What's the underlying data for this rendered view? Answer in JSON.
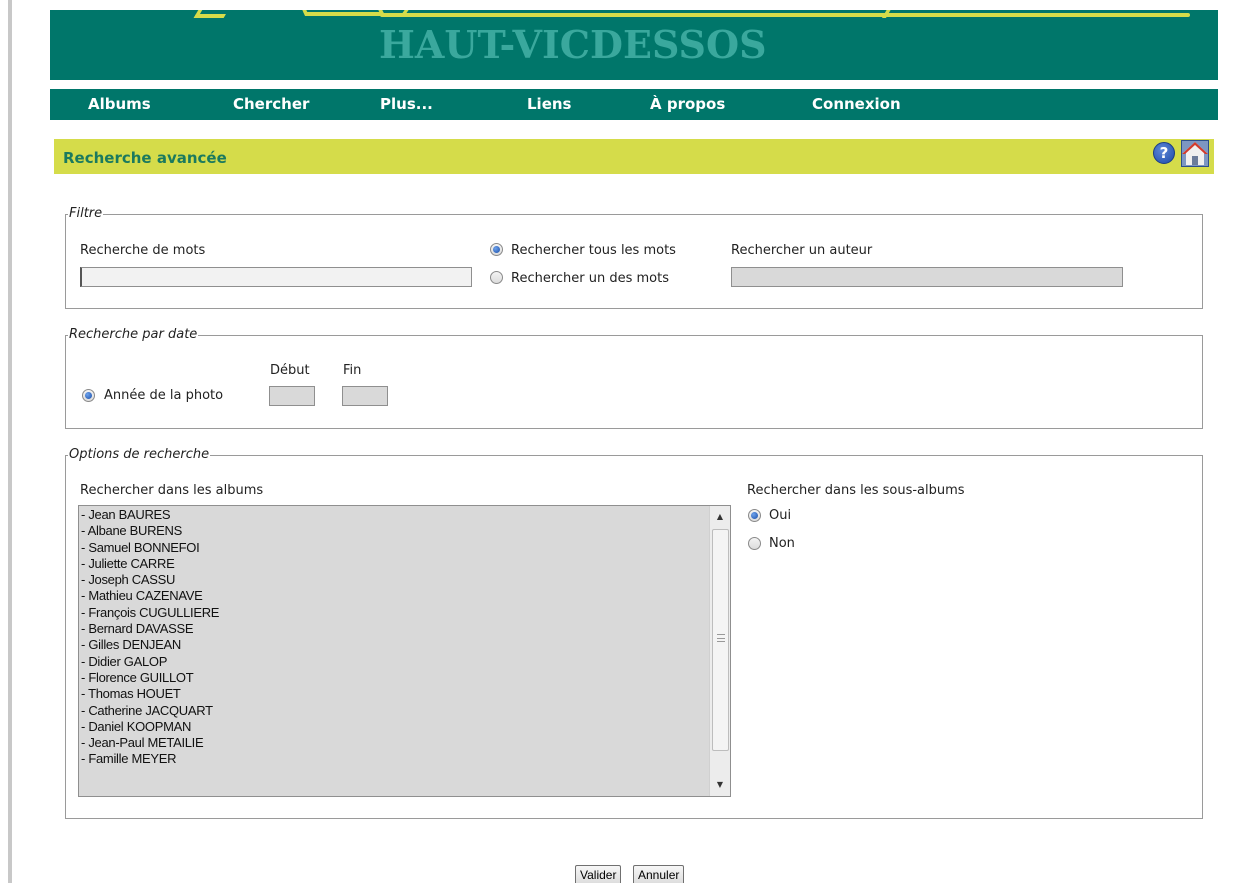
{
  "banner": {
    "title": "HAUT-VICDESSOS"
  },
  "nav": {
    "items": [
      {
        "label": "Albums"
      },
      {
        "label": "Chercher"
      },
      {
        "label": "Plus..."
      },
      {
        "label": "Liens"
      },
      {
        "label": "À propos"
      },
      {
        "label": "Connexion"
      }
    ]
  },
  "page": {
    "title": "Recherche avancée",
    "help_icon": "help-icon",
    "home_icon": "home-icon"
  },
  "filter": {
    "legend": "Filtre",
    "words_label": "Recherche de mots",
    "words_value": "",
    "mode_all": "Rechercher tous les mots",
    "mode_any": "Rechercher un des mots",
    "mode_selected": "all",
    "author_label": "Rechercher un auteur",
    "author_value": ""
  },
  "date": {
    "legend": "Recherche par date",
    "start_label": "Début",
    "end_label": "Fin",
    "photo_year_label": "Année de la photo",
    "start_value": "",
    "end_value": ""
  },
  "options": {
    "legend": "Options de recherche",
    "albums_label": "Rechercher dans les albums",
    "albums": [
      "- Jean BAURES",
      "- Albane BURENS",
      "- Samuel BONNEFOI",
      "- Juliette CARRE",
      "- Joseph CASSU",
      "- Mathieu CAZENAVE",
      "- François CUGULLIERE",
      "- Bernard DAVASSE",
      "- Gilles DENJEAN",
      "- Didier GALOP",
      "- Florence GUILLOT",
      "- Thomas HOUET",
      "- Catherine JACQUART",
      "- Daniel KOOPMAN",
      "- Jean-Paul METAILIE",
      "- Famille MEYER"
    ],
    "subalbums_label": "Rechercher dans les sous-albums",
    "subalbums_yes": "Oui",
    "subalbums_no": "Non",
    "subalbums_selected": "yes"
  },
  "buttons": {
    "submit": "Valider",
    "cancel": "Annuler"
  },
  "colors": {
    "banner": "#00766a",
    "titlebar": "#d5dc4a",
    "title_text": "#1b7a5e"
  }
}
